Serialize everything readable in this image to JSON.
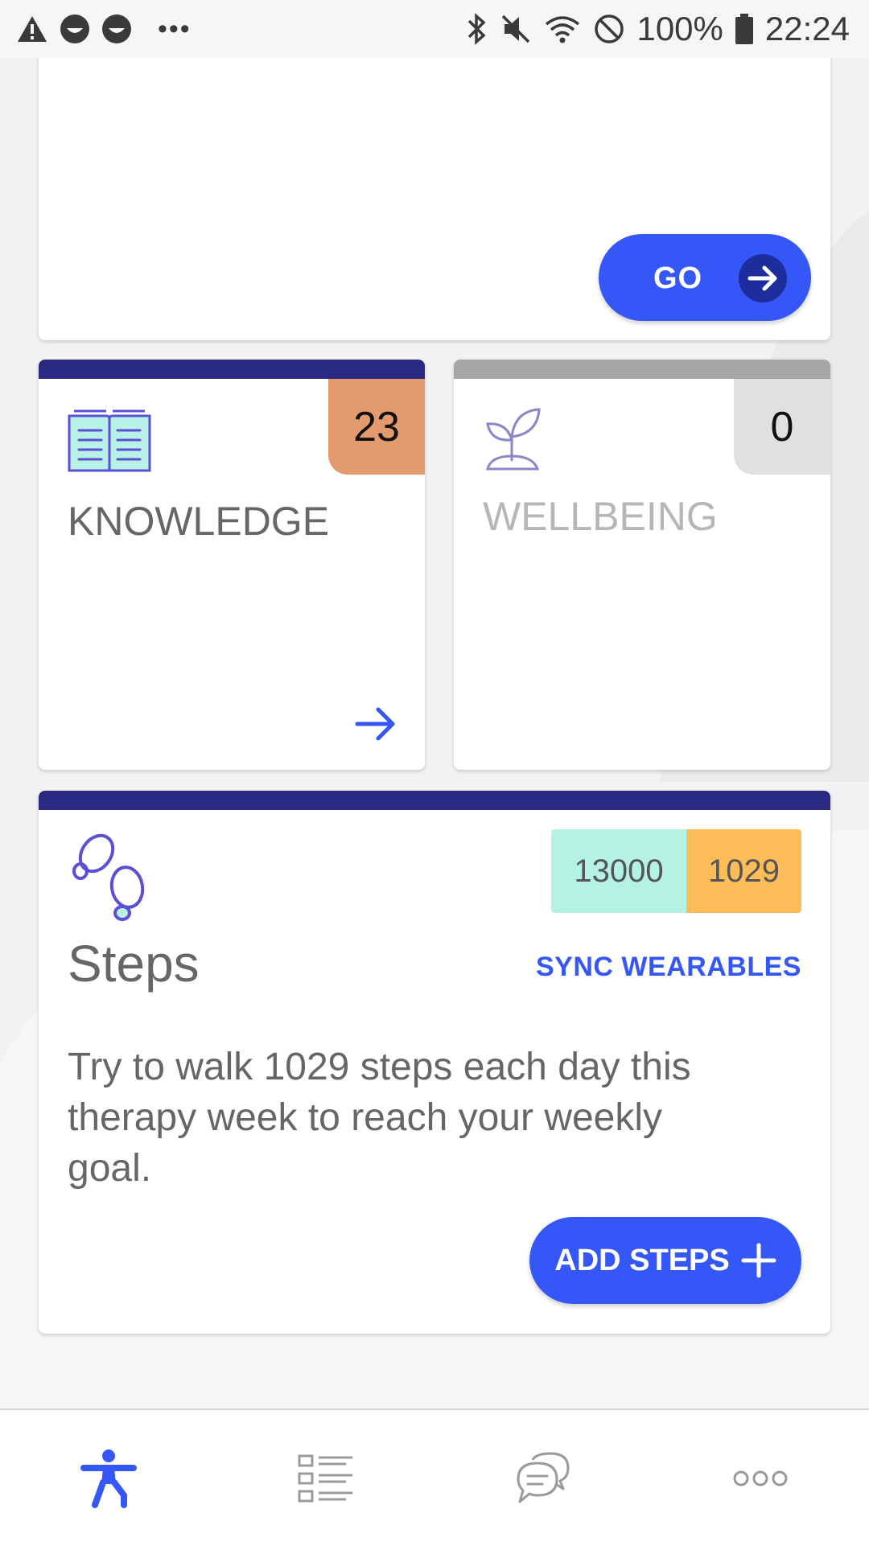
{
  "status_bar": {
    "battery": "100%",
    "time": "22:24",
    "left_icons": [
      "warning-icon",
      "face-icon",
      "face-icon",
      "more-dots"
    ],
    "right_icons": [
      "bluetooth-icon",
      "mute-icon",
      "wifi-icon",
      "dnd-icon",
      "battery-icon"
    ]
  },
  "top_card": {
    "go_label": "GO"
  },
  "knowledge": {
    "title": "KNOWLEDGE",
    "count": "23",
    "accent": "#2b2a82",
    "badge_color": "#e39a6d"
  },
  "wellbeing": {
    "title": "WELLBEING",
    "count": "0",
    "accent": "#a6a6a6",
    "badge_color": "#e0e0e0"
  },
  "steps": {
    "title": "Steps",
    "sync_label": "SYNC WEARABLES",
    "goal_total": "13000",
    "goal_daily": "1029",
    "description": "Try to walk 1029 steps each day this therapy week to reach your weekly goal.",
    "add_label": "ADD STEPS"
  },
  "bottom_nav": {
    "items": [
      "activity-icon",
      "list-icon",
      "chat-icon",
      "more-icon"
    ],
    "active": "activity-icon",
    "active_color": "#3557f7"
  }
}
